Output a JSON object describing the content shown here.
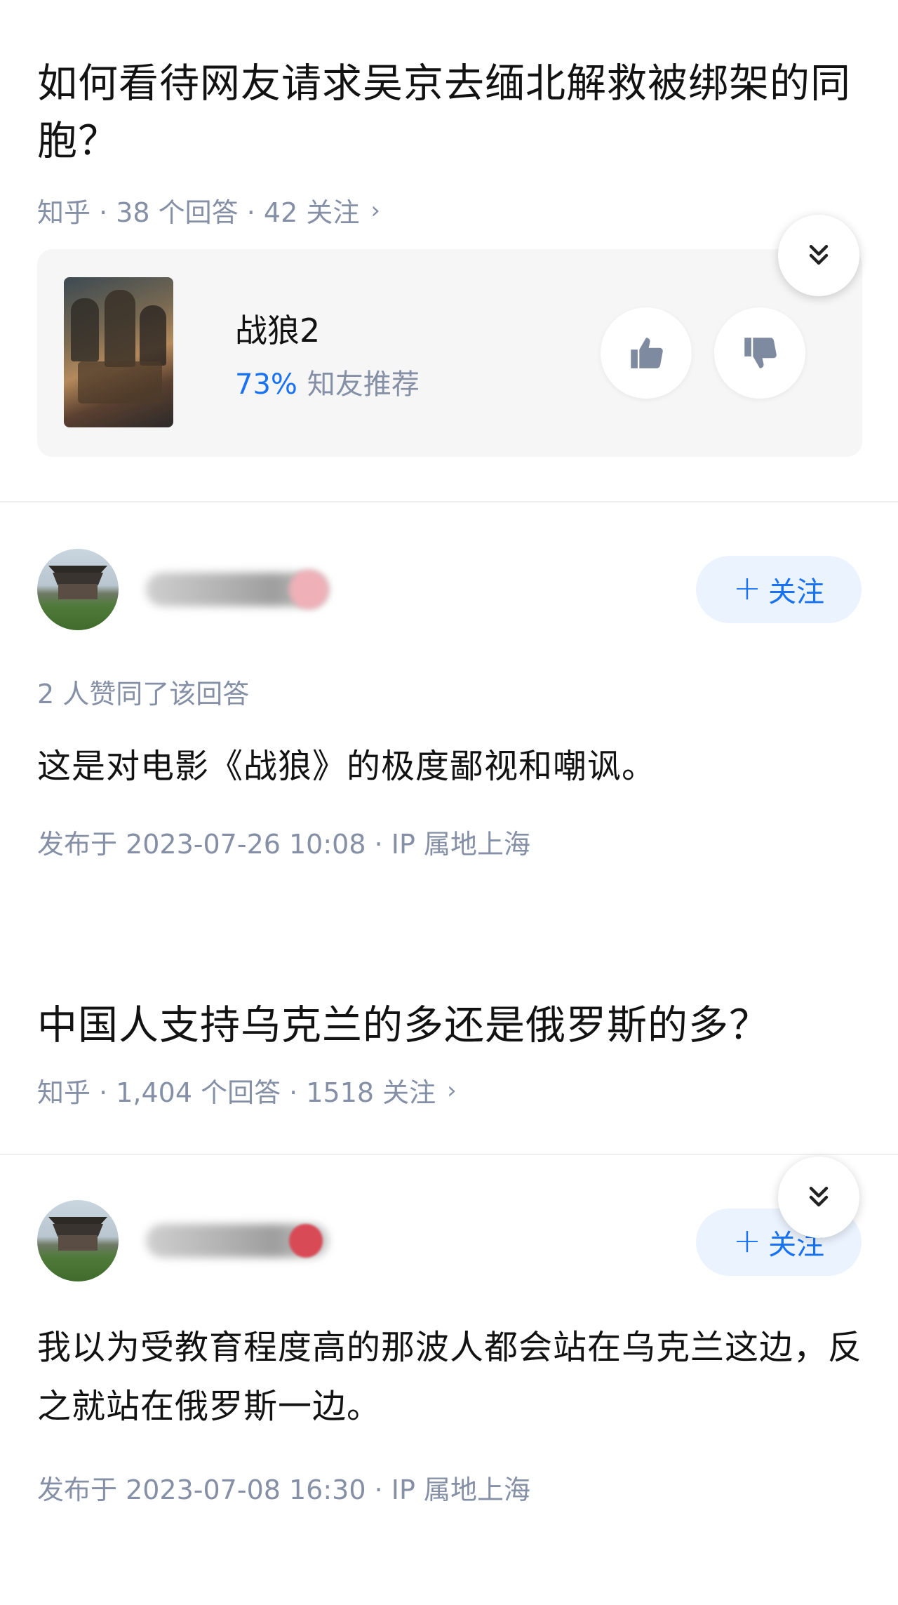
{
  "question1": {
    "title": "如何看待网友请求吴京去缅北解救被绑架的同胞？",
    "meta": "知乎 · 38 个回答 · 42 关注",
    "chevron": "›"
  },
  "movie": {
    "name": "战狼2",
    "percent": "73%",
    "recommend_label": "知友推荐",
    "poster_icon": "movie-poster-image",
    "like_icon": "thumbs-up-icon",
    "dislike_icon": "thumbs-down-icon"
  },
  "answer1": {
    "author_name": "",
    "follow_label": "关注",
    "follow_plus": "+",
    "votes": "2 人赞同了该回答",
    "content": "这是对电影《战狼》的极度鄙视和嘲讽。",
    "published": "发布于 2023-07-26 10:08 · IP 属地上海"
  },
  "question2": {
    "title": "中国人支持乌克兰的多还是俄罗斯的多？",
    "meta": "知乎 · 1,404 个回答 · 1518 关注",
    "chevron": "›"
  },
  "answer2": {
    "author_name": "",
    "follow_label": "关注",
    "follow_plus": "+",
    "content": "我以为受教育程度高的那波人都会站在乌克兰这边，反之就站在俄罗斯一边。",
    "published": "发布于 2023-07-08 16:30 · IP 属地上海"
  },
  "colors": {
    "accent_blue": "#1772f6",
    "meta_gray": "#8590a6",
    "card_bg": "#f6f6f6",
    "follow_bg": "#ebf3fe"
  }
}
